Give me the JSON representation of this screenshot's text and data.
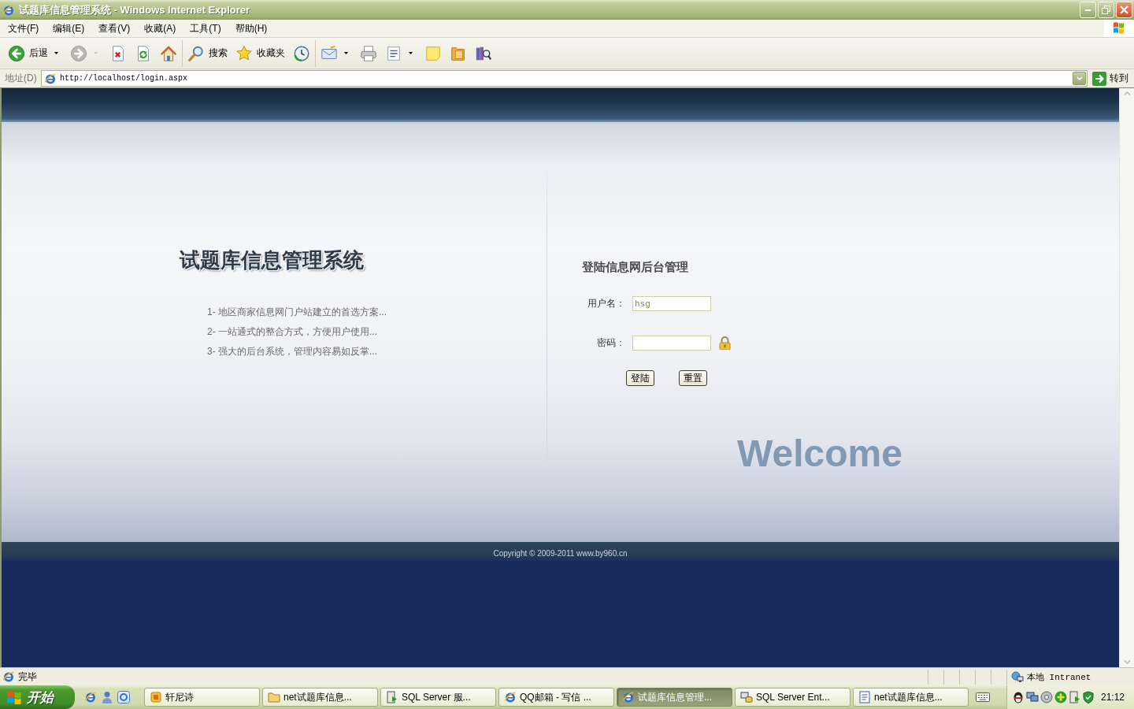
{
  "window": {
    "title": "试题库信息管理系统 - Windows Internet Explorer"
  },
  "menu_bar": {
    "items": [
      "文件(F)",
      "编辑(E)",
      "查看(V)",
      "收藏(A)",
      "工具(T)",
      "帮助(H)"
    ]
  },
  "toolbar": {
    "groups": [
      [
        {
          "kind": "back",
          "label": "后退",
          "disabled": false,
          "dropdown": true
        },
        {
          "kind": "forward",
          "disabled": true,
          "dropdown": true
        },
        {
          "kind": "stop",
          "disabled": false,
          "dropdown": false
        },
        {
          "kind": "refresh",
          "disabled": false,
          "dropdown": false
        },
        {
          "kind": "home",
          "disabled": false,
          "dropdown": false
        }
      ],
      [
        {
          "kind": "search",
          "label": "搜索",
          "disabled": false,
          "dropdown": false
        },
        {
          "kind": "favorites",
          "label": "收藏夹",
          "disabled": false,
          "dropdown": false
        },
        {
          "kind": "history",
          "disabled": false,
          "dropdown": false
        }
      ],
      [
        {
          "kind": "mail",
          "disabled": false,
          "dropdown": true
        },
        {
          "kind": "print",
          "disabled": false,
          "dropdown": false
        },
        {
          "kind": "edit",
          "disabled": false,
          "dropdown": true
        },
        {
          "kind": "notes",
          "disabled": false,
          "dropdown": false
        },
        {
          "kind": "folder",
          "disabled": false,
          "dropdown": false
        },
        {
          "kind": "research",
          "disabled": false,
          "dropdown": false
        }
      ]
    ]
  },
  "address_bar": {
    "label": "地址(D)",
    "url": "http://localhost/login.aspx",
    "go_label": "转到"
  },
  "page": {
    "site_title": "试题库信息管理系统",
    "features": [
      "1- 地区商家信息网门户站建立的首选方案...",
      "2- 一站通式的整合方式，方便用户使用...",
      "3- 强大的后台系统，管理内容易如反掌..."
    ],
    "login": {
      "title": "登陆信息网后台管理",
      "fields": [
        {
          "kind": "text",
          "label": "用户名：",
          "value": "hsg"
        },
        {
          "kind": "password",
          "label": "密码："
        }
      ],
      "buttons": [
        "登陆",
        "重置"
      ]
    },
    "welcome": "Welcome",
    "copyright": "Copyright © 2009-2011 www.by960.cn"
  },
  "status_bar": {
    "text": "完毕",
    "zone": "本地 Intranet"
  },
  "taskbar": {
    "start_label": "开始",
    "tasks": [
      {
        "kind": "app",
        "label": "轩尼诗",
        "selected": false
      },
      {
        "kind": "folder",
        "label": "net试题库信息...",
        "selected": false
      },
      {
        "kind": "service",
        "label": "SQL Server 服...",
        "selected": false
      },
      {
        "kind": "browser",
        "label": "QQ邮箱 - 写信 ...",
        "selected": false
      },
      {
        "kind": "browser",
        "label": "试题库信息管理...",
        "selected": true
      },
      {
        "kind": "console",
        "label": "SQL Server Ent...",
        "selected": false
      },
      {
        "kind": "document",
        "label": "net试题库信息...",
        "selected": false
      }
    ],
    "clock": "21:12"
  }
}
